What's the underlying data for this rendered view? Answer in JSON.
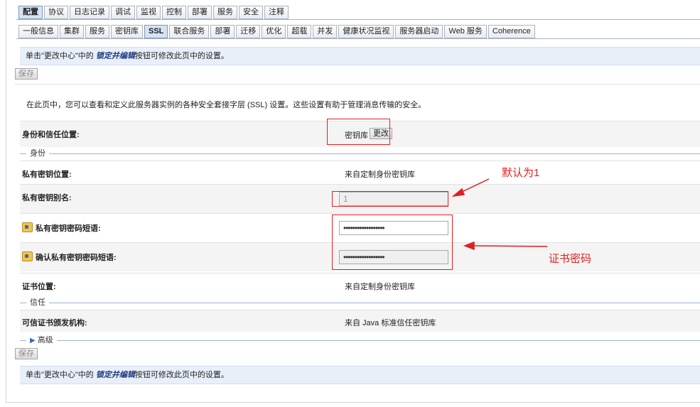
{
  "top_tabs": [
    "配置",
    "协议",
    "日志记录",
    "调试",
    "监视",
    "控制",
    "部署",
    "服务",
    "安全",
    "注释"
  ],
  "top_tabs_active": 0,
  "sub_tabs": [
    "一般信息",
    "集群",
    "服务",
    "密钥库",
    "SSL",
    "联合服务",
    "部署",
    "迁移",
    "优化",
    "超载",
    "并发",
    "健康状况监视",
    "服务器启动",
    "Web 服务",
    "Coherence"
  ],
  "sub_tabs_active": 4,
  "notice": {
    "prefix": "单击\"更改中心\"中的 ",
    "emph": "锁定并编辑",
    "suffix": "按钮可修改此页中的设置。"
  },
  "save_label": "保存",
  "description": "在此页中，您可以查看和定义此服务器实例的各种安全套接字层 (SSL) 设置。这些设置有助于管理消息传输的安全。",
  "identity_trust": {
    "label": "身份和信任位置:",
    "value": "密钥库",
    "button": "更改"
  },
  "sections": {
    "identity": "身份",
    "trust": "信任",
    "advanced": "高级"
  },
  "private_key_location": {
    "label": "私有密钥位置:",
    "value": "来自定制身份密钥库"
  },
  "private_key_alias": {
    "label": "私有密钥别名:",
    "value": "1"
  },
  "private_key_passphrase": {
    "label": "私有密钥密码短语:",
    "value": "••••••••••••••••••"
  },
  "confirm_passphrase": {
    "label": "确认私有密钥密码短语:",
    "value": "••••••••••••••••••"
  },
  "cert_location": {
    "label": "证书位置:",
    "value": "来自定制身份密钥库"
  },
  "trusted_ca": {
    "label": "可信证书颁发机构:",
    "value": "来自 Java 标准信任密钥库"
  },
  "annotations": {
    "default_one": "默认为1",
    "cert_password": "证书密码"
  },
  "colors": {
    "annotation": "#e02020",
    "notice_bg": "#e9eff8",
    "active_tab": "#d6e3f3"
  }
}
